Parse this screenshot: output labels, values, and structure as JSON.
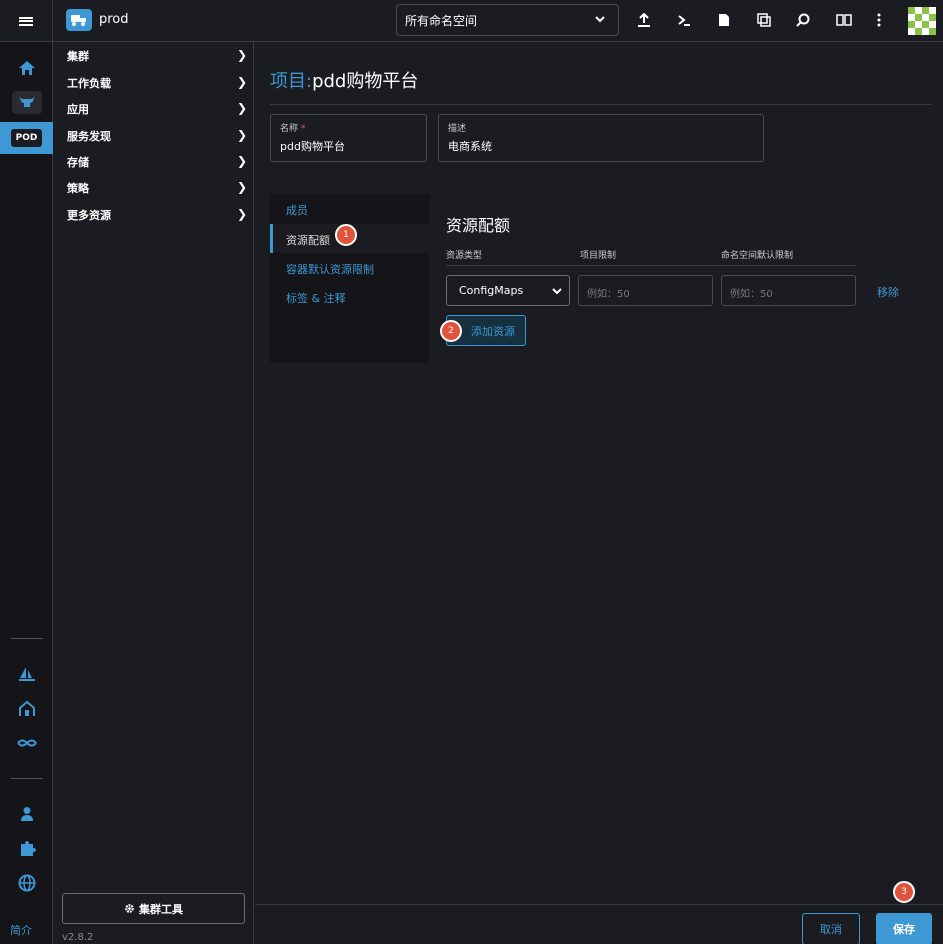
{
  "header": {
    "cluster_name": "prod",
    "namespace_selector": "所有命名空间",
    "icons": [
      "upload-icon",
      "terminal-icon",
      "file-icon",
      "copy-icon",
      "search-icon",
      "book-icon",
      "more-vert-icon"
    ]
  },
  "iconbar": {
    "pod_label": "POD",
    "intro_link": "简介"
  },
  "nav": {
    "items": [
      {
        "label": "集群"
      },
      {
        "label": "工作负载"
      },
      {
        "label": "应用"
      },
      {
        "label": "服务发现"
      },
      {
        "label": "存储"
      },
      {
        "label": "策略"
      },
      {
        "label": "更多资源"
      }
    ],
    "cluster_tools": "集群工具",
    "version": "v2.8.2"
  },
  "page": {
    "title_prefix": "项目:",
    "title_name": "pdd购物平台",
    "name_label": "名称",
    "name_required": "*",
    "name_value": "pdd购物平台",
    "desc_label": "描述",
    "desc_value": "电商系统"
  },
  "tabs": [
    {
      "label": "成员"
    },
    {
      "label": "资源配额"
    },
    {
      "label": "容器默认资源限制"
    },
    {
      "label": "标签 & 注释"
    }
  ],
  "quota": {
    "title": "资源配额",
    "col_type": "资源类型",
    "col_project": "项目限制",
    "col_namespace": "命名空间默认限制",
    "resource_type": "ConfigMaps",
    "project_placeholder": "例如：50",
    "namespace_placeholder": "例如：50",
    "remove": "移除",
    "add_resource": "添加资源"
  },
  "markers": [
    "1",
    "2",
    "3"
  ],
  "footer": {
    "cancel": "取消",
    "save": "保存"
  },
  "colors": {
    "accent": "#3d98d3",
    "marker": "#e0533d",
    "background": "#1b1c21"
  }
}
